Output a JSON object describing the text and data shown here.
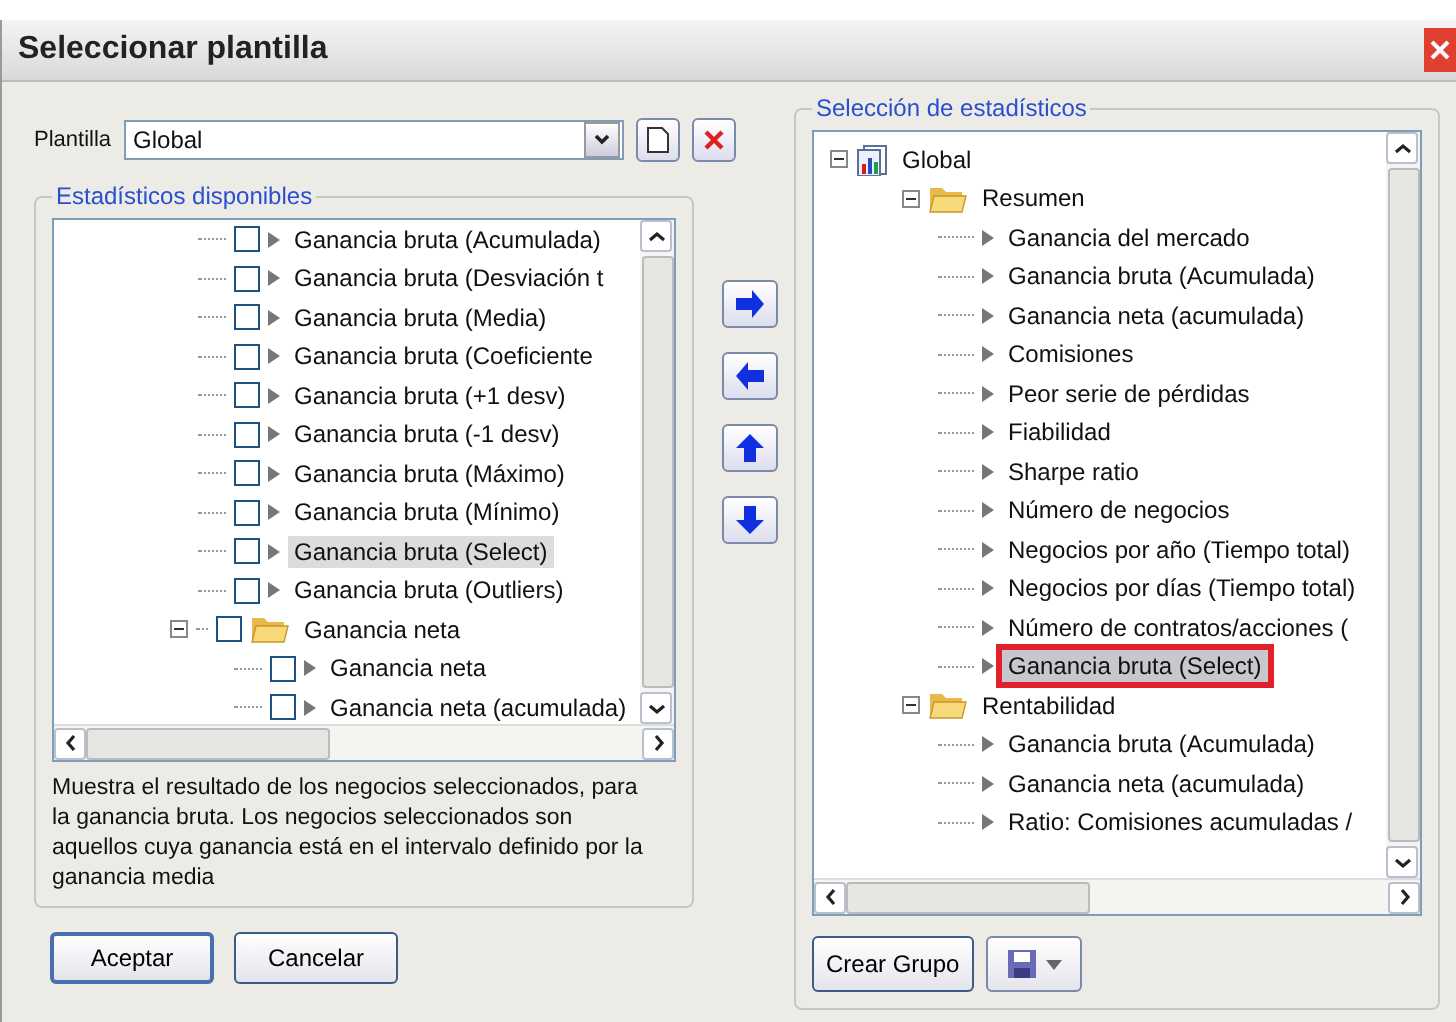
{
  "window": {
    "title": "Seleccionar plantilla"
  },
  "template": {
    "label": "Plantilla",
    "value": "Global"
  },
  "available": {
    "title": "Estadísticos disponibles",
    "nodes": [
      {
        "kind": "leaf",
        "label": "Ganancia bruta (Acumulada)",
        "checked": false,
        "selected": false
      },
      {
        "kind": "leaf",
        "label": "Ganancia bruta (Desviación t",
        "checked": false,
        "selected": false
      },
      {
        "kind": "leaf",
        "label": "Ganancia bruta (Media)",
        "checked": false,
        "selected": false
      },
      {
        "kind": "leaf",
        "label": "Ganancia bruta (Coeficiente",
        "checked": false,
        "selected": false
      },
      {
        "kind": "leaf",
        "label": "Ganancia bruta (+1 desv)",
        "checked": false,
        "selected": false
      },
      {
        "kind": "leaf",
        "label": "Ganancia bruta (-1 desv)",
        "checked": false,
        "selected": false
      },
      {
        "kind": "leaf",
        "label": "Ganancia bruta (Máximo)",
        "checked": false,
        "selected": false
      },
      {
        "kind": "leaf",
        "label": "Ganancia bruta (Mínimo)",
        "checked": false,
        "selected": false
      },
      {
        "kind": "leaf",
        "label": "Ganancia bruta (Select)",
        "checked": false,
        "selected": true
      },
      {
        "kind": "leaf",
        "label": "Ganancia bruta (Outliers)",
        "checked": false,
        "selected": false
      },
      {
        "kind": "folder",
        "label": "Ganancia neta",
        "checked": false,
        "selected": false,
        "expanded": true,
        "children": [
          {
            "kind": "leaf",
            "label": "Ganancia neta",
            "checked": false,
            "selected": false
          },
          {
            "kind": "leaf",
            "label": "Ganancia neta (acumulada)",
            "checked": false,
            "selected": false
          }
        ]
      }
    ],
    "description": "Muestra el resultado de los negocios seleccionados, para la ganancia bruta. Los negocios seleccionados son aquellos cuya ganancia está en el intervalo definido por la ganancia media"
  },
  "selection": {
    "title": "Selección de estadísticos",
    "nodes": [
      {
        "kind": "root",
        "label": "Global",
        "selected": false,
        "expanded": true,
        "children": [
          {
            "kind": "folder",
            "label": "Resumen",
            "selected": false,
            "expanded": true,
            "children": [
              {
                "kind": "leaf",
                "label": "Ganancia del mercado",
                "selected": false
              },
              {
                "kind": "leaf",
                "label": "Ganancia bruta (Acumulada)",
                "selected": false
              },
              {
                "kind": "leaf",
                "label": "Ganancia neta (acumulada)",
                "selected": false
              },
              {
                "kind": "leaf",
                "label": "Comisiones",
                "selected": false
              },
              {
                "kind": "leaf",
                "label": "Peor serie de pérdidas",
                "selected": false
              },
              {
                "kind": "leaf",
                "label": "Fiabilidad",
                "selected": false
              },
              {
                "kind": "leaf",
                "label": "Sharpe ratio",
                "selected": false
              },
              {
                "kind": "leaf",
                "label": "Número de negocios",
                "selected": false
              },
              {
                "kind": "leaf",
                "label": "Negocios por año (Tiempo total)",
                "selected": false
              },
              {
                "kind": "leaf",
                "label": "Negocios por días (Tiempo total)",
                "selected": false
              },
              {
                "kind": "leaf",
                "label": "Número de contratos/acciones (",
                "selected": false
              },
              {
                "kind": "leaf",
                "label": "Ganancia bruta (Select)",
                "selected": true
              }
            ]
          },
          {
            "kind": "folder",
            "label": "Rentabilidad",
            "selected": false,
            "expanded": true,
            "children": [
              {
                "kind": "leaf",
                "label": "Ganancia bruta (Acumulada)",
                "selected": false
              },
              {
                "kind": "leaf",
                "label": "Ganancia neta (acumulada)",
                "selected": false
              },
              {
                "kind": "leaf",
                "label": "Ratio: Comisiones acumuladas /",
                "selected": false
              }
            ]
          }
        ]
      }
    ]
  },
  "buttons": {
    "accept": "Aceptar",
    "cancel": "Cancelar",
    "create_group": "Crear Grupo"
  }
}
